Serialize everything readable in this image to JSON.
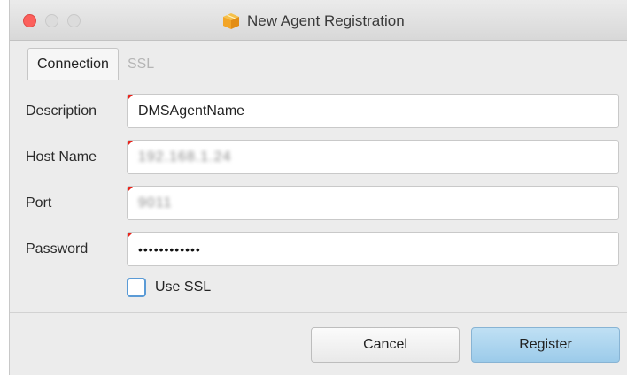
{
  "window": {
    "title": "New Agent Registration",
    "title_icon": "package-box-icon"
  },
  "tabs": [
    {
      "label": "Connection",
      "active": true
    },
    {
      "label": "SSL",
      "active": false
    }
  ],
  "form": {
    "description": {
      "label": "Description",
      "value": "DMSAgentName"
    },
    "host_name": {
      "label": "Host Name",
      "value": "192.168.1.24"
    },
    "port": {
      "label": "Port",
      "value": "9011"
    },
    "password": {
      "label": "Password",
      "value": "••••••••••••"
    }
  },
  "use_ssl": {
    "label": "Use SSL",
    "checked": false
  },
  "buttons": {
    "cancel": "Cancel",
    "register": "Register"
  },
  "colors": {
    "accent": "#5b9bd6",
    "register_button": "#9ccbea",
    "required_marker": "#e8231b",
    "close_button": "#fc605c"
  }
}
